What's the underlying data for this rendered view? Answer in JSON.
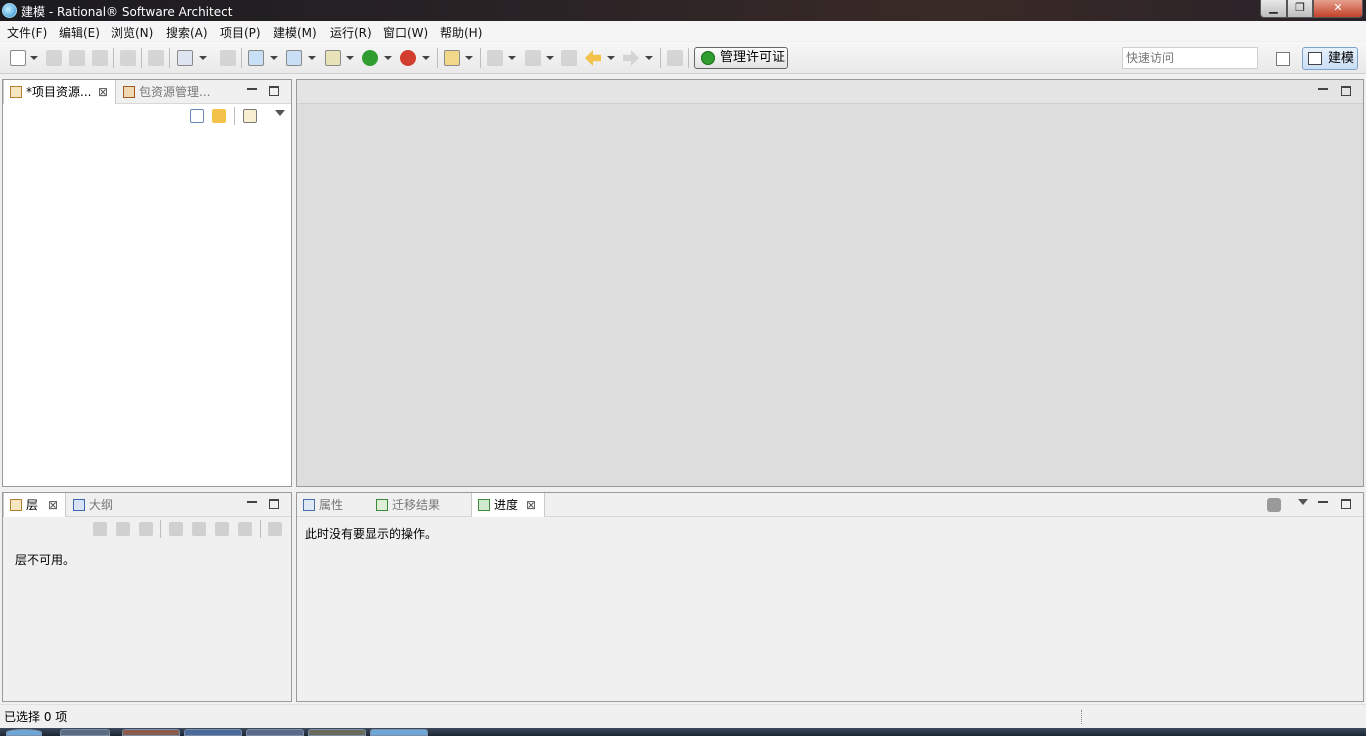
{
  "window": {
    "title": "建模 - Rational® Software Architect",
    "controls": {
      "minimize": "▁",
      "maximize": "❐",
      "close": "✕"
    }
  },
  "menu": [
    "文件(F)",
    "编辑(E)",
    "浏览(N)",
    "搜索(A)",
    "项目(P)",
    "建模(M)",
    "运行(R)",
    "窗口(W)",
    "帮助(H)"
  ],
  "toolbar": {
    "license_button": "管理许可证",
    "quick_access_placeholder": "快速访问",
    "perspective_label": "建模"
  },
  "left_panel": {
    "tabs": [
      {
        "label": "*项目资源...",
        "close": "⊠",
        "icon": "project-explorer-icon"
      },
      {
        "label": "包资源管理...",
        "icon": "package-explorer-icon"
      }
    ]
  },
  "layers_panel": {
    "tabs": [
      {
        "label": "层",
        "close": "⊠",
        "icon": "layers-icon"
      },
      {
        "label": "大纲",
        "icon": "outline-icon"
      }
    ],
    "message": "层不可用。"
  },
  "bottom_panel": {
    "tabs": [
      {
        "label": "属性",
        "icon": "properties-icon"
      },
      {
        "label": "迁移结果",
        "icon": "migration-results-icon"
      },
      {
        "label": "进度",
        "close": "⊠",
        "icon": "progress-icon"
      }
    ],
    "message": "此时没有要显示的操作。"
  },
  "status": {
    "selection": "已选择 0 项"
  },
  "colors": {
    "editor_bg": "#dddddd",
    "accent": "#2f9d2f",
    "titlebar": "#1b1b1f"
  }
}
